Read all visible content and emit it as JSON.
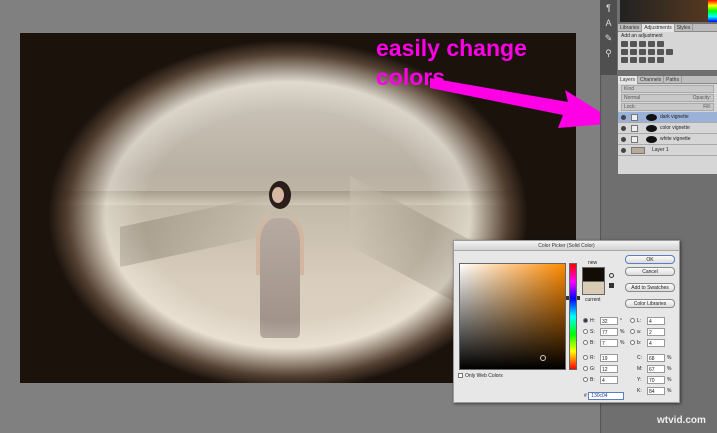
{
  "annotation": {
    "line1": "easily change",
    "line2": "colors",
    "color": "#ff00e6"
  },
  "panels": {
    "tools": [
      "paragraph-icon",
      "character-icon",
      "brush-icon",
      "clone-icon"
    ],
    "top_tabs": [
      {
        "label": "Libraries",
        "active": false
      },
      {
        "label": "Adjustments",
        "active": true
      },
      {
        "label": "Styles",
        "active": false
      }
    ],
    "adjustments_title": "Add an adjustment",
    "layer_tabs": [
      {
        "label": "Layers",
        "active": true
      },
      {
        "label": "Channels",
        "active": false
      },
      {
        "label": "Paths",
        "active": false
      }
    ],
    "layer_filter": "Kind",
    "blend_mode": "Normal",
    "opacity_label": "Opacity:",
    "lock_label": "Lock:",
    "fill_label": "Fill:",
    "layers": [
      {
        "name": "dark vignette",
        "selected": true
      },
      {
        "name": "color vignette",
        "selected": false
      },
      {
        "name": "white vignette",
        "selected": false
      },
      {
        "name": "Layer 1",
        "selected": false
      }
    ]
  },
  "picker": {
    "title": "Color Picker (Solid Color)",
    "new_label": "new",
    "current_label": "current",
    "new_color": "#130c04",
    "current_color": "#d9cbb4",
    "buttons": {
      "ok": "OK",
      "cancel": "Cancel",
      "add_swatches": "Add to Swatches",
      "libraries": "Color Libraries"
    },
    "fields_left": [
      {
        "label": "H:",
        "value": "32",
        "unit": "°",
        "selected": true
      },
      {
        "label": "S:",
        "value": "77",
        "unit": "%",
        "selected": false
      },
      {
        "label": "B:",
        "value": "7",
        "unit": "%",
        "selected": false
      },
      {
        "label": "R:",
        "value": "19",
        "unit": "",
        "selected": false
      },
      {
        "label": "G:",
        "value": "12",
        "unit": "",
        "selected": false
      },
      {
        "label": "B:",
        "value": "4",
        "unit": "",
        "selected": false
      }
    ],
    "fields_right": [
      {
        "label": "L:",
        "value": "4",
        "unit": ""
      },
      {
        "label": "a:",
        "value": "2",
        "unit": ""
      },
      {
        "label": "b:",
        "value": "4",
        "unit": ""
      },
      {
        "label": "C:",
        "value": "68",
        "unit": "%"
      },
      {
        "label": "M:",
        "value": "67",
        "unit": "%"
      },
      {
        "label": "Y:",
        "value": "70",
        "unit": "%"
      },
      {
        "label": "K:",
        "value": "84",
        "unit": "%"
      }
    ],
    "hex_label": "#",
    "hex_value": "130c04",
    "web_only_label": "Only Web Colors"
  },
  "watermark": "wtvid.com"
}
